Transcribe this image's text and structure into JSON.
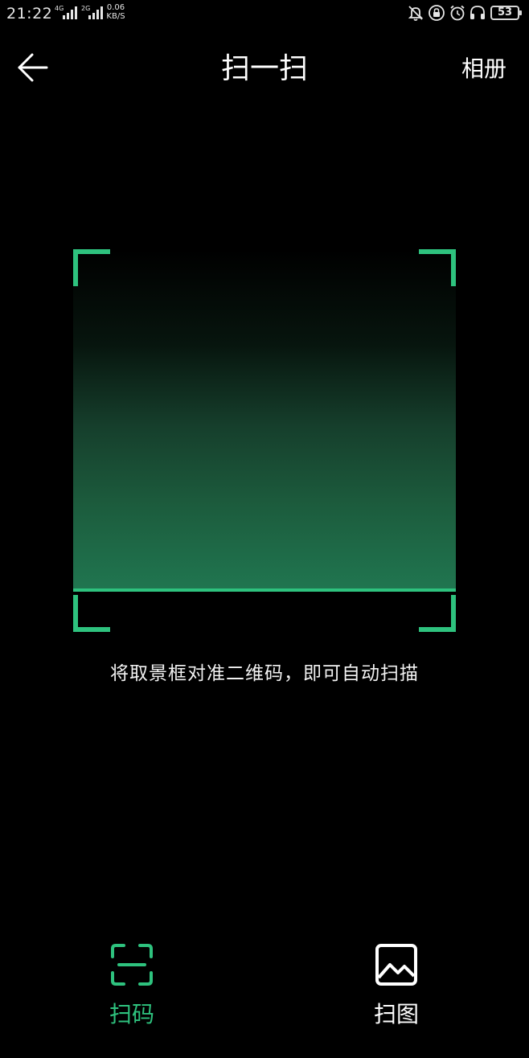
{
  "status_bar": {
    "time": "21:22",
    "signal_1_label": "4G",
    "signal_2_label": "2G",
    "net_speed_value": "0.06",
    "net_speed_unit": "KB/S",
    "battery_level": "53",
    "icons": [
      "bell-off-icon",
      "lock-rotation-icon",
      "alarm-icon",
      "headphones-icon",
      "battery-icon"
    ]
  },
  "header": {
    "back_icon": "arrow-left-icon",
    "title": "扫一扫",
    "album_label": "相册"
  },
  "scanner": {
    "accent_color": "#2ec27e",
    "hint": "将取景框对准二维码，即可自动扫描"
  },
  "tabs": [
    {
      "label": "扫码",
      "icon": "scan-code-icon",
      "active": true
    },
    {
      "label": "扫图",
      "icon": "image-icon",
      "active": false
    }
  ],
  "colors": {
    "background": "#000000",
    "accent": "#2ec27e",
    "text": "#ffffff"
  }
}
